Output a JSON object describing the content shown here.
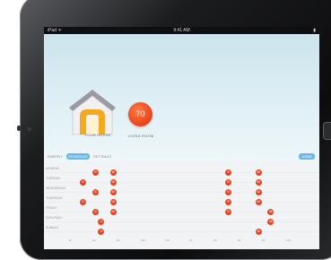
{
  "status_bar": {
    "carrier": "iPad ᯤ",
    "time": "9:41 AM",
    "battery": "▮"
  },
  "home": {
    "away_label": "YOUR HOUSE",
    "temp_value": "70",
    "temp_label": "LIVING ROOM"
  },
  "tabs": [
    {
      "label": "ENERGY",
      "active": false
    },
    {
      "label": "SCHEDULE",
      "active": true
    },
    {
      "label": "SETTINGS",
      "active": false
    }
  ],
  "done_label": "DONE",
  "schedule": {
    "days": [
      "MONDAY",
      "TUESDAY",
      "WEDNESDAY",
      "THURSDAY",
      "FRIDAY",
      "SATURDAY",
      "SUNDAY"
    ],
    "hours": [
      "4A",
      "6A",
      "8A",
      "10A",
      "12P",
      "2P",
      "4P",
      "6P",
      "8P",
      "10P"
    ],
    "setpoints": [
      {
        "day": 0,
        "hour": 6.0,
        "temp": "70"
      },
      {
        "day": 0,
        "hour": 7.5,
        "temp": "68"
      },
      {
        "day": 0,
        "hour": 17.0,
        "temp": "70"
      },
      {
        "day": 0,
        "hour": 19.5,
        "temp": "68"
      },
      {
        "day": 1,
        "hour": 5.0,
        "temp": "70"
      },
      {
        "day": 1,
        "hour": 7.5,
        "temp": "68"
      },
      {
        "day": 1,
        "hour": 17.0,
        "temp": "70"
      },
      {
        "day": 1,
        "hour": 19.5,
        "temp": "68"
      },
      {
        "day": 2,
        "hour": 6.0,
        "temp": "70"
      },
      {
        "day": 2,
        "hour": 7.5,
        "temp": "68"
      },
      {
        "day": 2,
        "hour": 17.0,
        "temp": "70"
      },
      {
        "day": 2,
        "hour": 19.5,
        "temp": "68"
      },
      {
        "day": 3,
        "hour": 5.0,
        "temp": "70"
      },
      {
        "day": 3,
        "hour": 7.5,
        "temp": "68"
      },
      {
        "day": 3,
        "hour": 17.0,
        "temp": "70"
      },
      {
        "day": 3,
        "hour": 19.5,
        "temp": "68"
      },
      {
        "day": 4,
        "hour": 6.0,
        "temp": "70"
      },
      {
        "day": 4,
        "hour": 7.5,
        "temp": "68"
      },
      {
        "day": 4,
        "hour": 17.0,
        "temp": "70"
      },
      {
        "day": 4,
        "hour": 20.5,
        "temp": "68"
      },
      {
        "day": 5,
        "hour": 6.5,
        "temp": "70"
      },
      {
        "day": 5,
        "hour": 20.5,
        "temp": "68"
      },
      {
        "day": 6,
        "hour": 6.5,
        "temp": "70"
      },
      {
        "day": 6,
        "hour": 19.5,
        "temp": "68"
      }
    ]
  },
  "colors": {
    "accent": "#6cb6e4",
    "setpoint": "#e5431e"
  }
}
